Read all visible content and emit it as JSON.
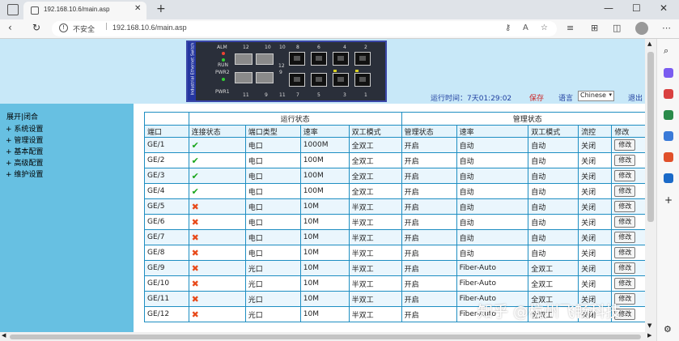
{
  "browser": {
    "tab_title": "192.168.10.6/main.asp",
    "close_glyph": "✕",
    "new_tab_glyph": "+",
    "security_label": "不安全",
    "url": "192.168.10.6/main.asp",
    "min_glyph": "—",
    "max_glyph": "☐",
    "winclose_glyph": "✕",
    "back_glyph": "‹",
    "forward_glyph": "›",
    "reload_glyph": "↻",
    "home_glyph": "⌂"
  },
  "device": {
    "side_text": "Industrial Ethernet Switch",
    "alm": "ALM",
    "run": "RUN",
    "pwr2": "PWR2",
    "pwr1": "PWR1",
    "port_top": [
      "12",
      "10",
      "10",
      "8",
      "6",
      "4",
      "2"
    ],
    "port_bottom": [
      "11",
      "9",
      "11",
      "7",
      "5",
      "3",
      "1"
    ],
    "mid_top": "12",
    "mid_mid": "9"
  },
  "header": {
    "runtime": "运行时间：7天01:29:02",
    "save": "保存",
    "language_label": "语言",
    "language_value": "Chinese",
    "logout": "退出"
  },
  "sidebar": {
    "expand_collapse": "展开|闭合",
    "items": [
      "系统设置",
      "管理设置",
      "基本配置",
      "高级配置",
      "维护设置"
    ]
  },
  "table": {
    "section_run": "运行状态",
    "section_manage": "管理状态",
    "headers": [
      "端口",
      "连接状态",
      "端口类型",
      "速率",
      "双工模式",
      "管理状态",
      "速率",
      "双工模式",
      "流控",
      "修改"
    ],
    "modify_label": "修改",
    "rows": [
      {
        "port": "GE/1",
        "link": "ok",
        "type": "电口",
        "speed": "1000M",
        "duplex": "全双工",
        "admin": "开启",
        "cfg_speed": "自动",
        "cfg_duplex": "自动",
        "flow": "关闭"
      },
      {
        "port": "GE/2",
        "link": "ok",
        "type": "电口",
        "speed": "100M",
        "duplex": "全双工",
        "admin": "开启",
        "cfg_speed": "自动",
        "cfg_duplex": "自动",
        "flow": "关闭"
      },
      {
        "port": "GE/3",
        "link": "ok",
        "type": "电口",
        "speed": "100M",
        "duplex": "全双工",
        "admin": "开启",
        "cfg_speed": "自动",
        "cfg_duplex": "自动",
        "flow": "关闭"
      },
      {
        "port": "GE/4",
        "link": "ok",
        "type": "电口",
        "speed": "100M",
        "duplex": "全双工",
        "admin": "开启",
        "cfg_speed": "自动",
        "cfg_duplex": "自动",
        "flow": "关闭"
      },
      {
        "port": "GE/5",
        "link": "bad",
        "type": "电口",
        "speed": "10M",
        "duplex": "半双工",
        "admin": "开启",
        "cfg_speed": "自动",
        "cfg_duplex": "自动",
        "flow": "关闭"
      },
      {
        "port": "GE/6",
        "link": "bad",
        "type": "电口",
        "speed": "10M",
        "duplex": "半双工",
        "admin": "开启",
        "cfg_speed": "自动",
        "cfg_duplex": "自动",
        "flow": "关闭"
      },
      {
        "port": "GE/7",
        "link": "bad",
        "type": "电口",
        "speed": "10M",
        "duplex": "半双工",
        "admin": "开启",
        "cfg_speed": "自动",
        "cfg_duplex": "自动",
        "flow": "关闭"
      },
      {
        "port": "GE/8",
        "link": "bad",
        "type": "电口",
        "speed": "10M",
        "duplex": "半双工",
        "admin": "开启",
        "cfg_speed": "自动",
        "cfg_duplex": "自动",
        "flow": "关闭"
      },
      {
        "port": "GE/9",
        "link": "bad",
        "type": "光口",
        "speed": "10M",
        "duplex": "半双工",
        "admin": "开启",
        "cfg_speed": "Fiber-Auto",
        "cfg_duplex": "全双工",
        "flow": "关闭"
      },
      {
        "port": "GE/10",
        "link": "bad",
        "type": "光口",
        "speed": "10M",
        "duplex": "半双工",
        "admin": "开启",
        "cfg_speed": "Fiber-Auto",
        "cfg_duplex": "全双工",
        "flow": "关闭"
      },
      {
        "port": "GE/11",
        "link": "bad",
        "type": "光口",
        "speed": "10M",
        "duplex": "半双工",
        "admin": "开启",
        "cfg_speed": "Fiber-Auto",
        "cfg_duplex": "全双工",
        "flow": "关闭"
      },
      {
        "port": "GE/12",
        "link": "bad",
        "type": "光口",
        "speed": "10M",
        "duplex": "半双工",
        "admin": "开启",
        "cfg_speed": "Fiber-Auto",
        "cfg_duplex": "全双工",
        "flow": "关闭"
      }
    ]
  },
  "icons": {
    "ok": "✔",
    "bad": "✖"
  },
  "colors": {
    "header_bg": "#c8e8f8",
    "sidebar_bg": "#67c0e2",
    "table_border": "#1e8ec2",
    "ok": "#1aa51a",
    "bad": "#e84a1a",
    "link_red": "#cc2a2a",
    "link_blue": "#1f3fa0"
  },
  "watermark": "知乎 @杭州飞畅科技"
}
